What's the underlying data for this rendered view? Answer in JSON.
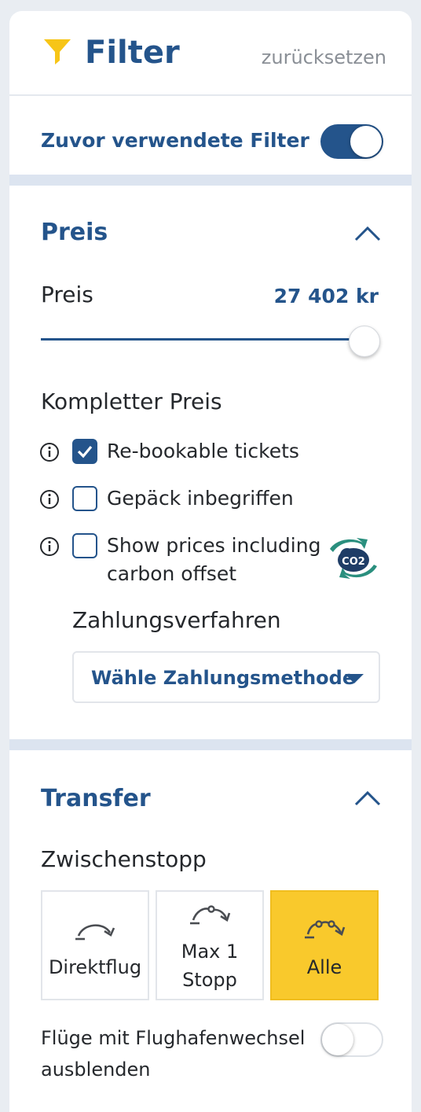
{
  "header": {
    "title": "Filter",
    "reset_label": "zurücksetzen"
  },
  "previous_filters": {
    "label": "Zuvor verwendete Filter",
    "enabled": true
  },
  "price_section": {
    "title": "Preis",
    "price_label": "Preis",
    "price_value": "27 402 kr",
    "slider_level": 1.0,
    "complete_price_label": "Kompletter Preis",
    "options": [
      {
        "label": "Re-bookable tickets",
        "checked": true
      },
      {
        "label": "Gepäck inbegriffen",
        "checked": false
      },
      {
        "label_line1": "Show prices including",
        "label_line2": "carbon offset",
        "checked": false,
        "badge_text": "CO2"
      }
    ],
    "payment_label": "Zahlungsverfahren",
    "payment_placeholder": "Wähle Zahlungsmethode"
  },
  "transfer_section": {
    "title": "Transfer",
    "stopover_label": "Zwischenstopp",
    "stop_options": [
      {
        "label": "Direktflug",
        "selected": false,
        "icon": "direct-flight-icon"
      },
      {
        "label_line1": "Max 1",
        "label_line2": "Stopp",
        "selected": false,
        "icon": "one-stop-icon"
      },
      {
        "label": "Alle",
        "selected": true,
        "icon": "all-stops-icon"
      }
    ],
    "hide_airport_change": {
      "line1": "Flüge mit Flughafenwechsel",
      "line2": "ausblenden",
      "enabled": false
    }
  },
  "colors": {
    "brand": "#24548b",
    "accent": "#f9c92c",
    "icon_yellow": "#f7c517",
    "co2_teal": "#2a8f7e"
  }
}
